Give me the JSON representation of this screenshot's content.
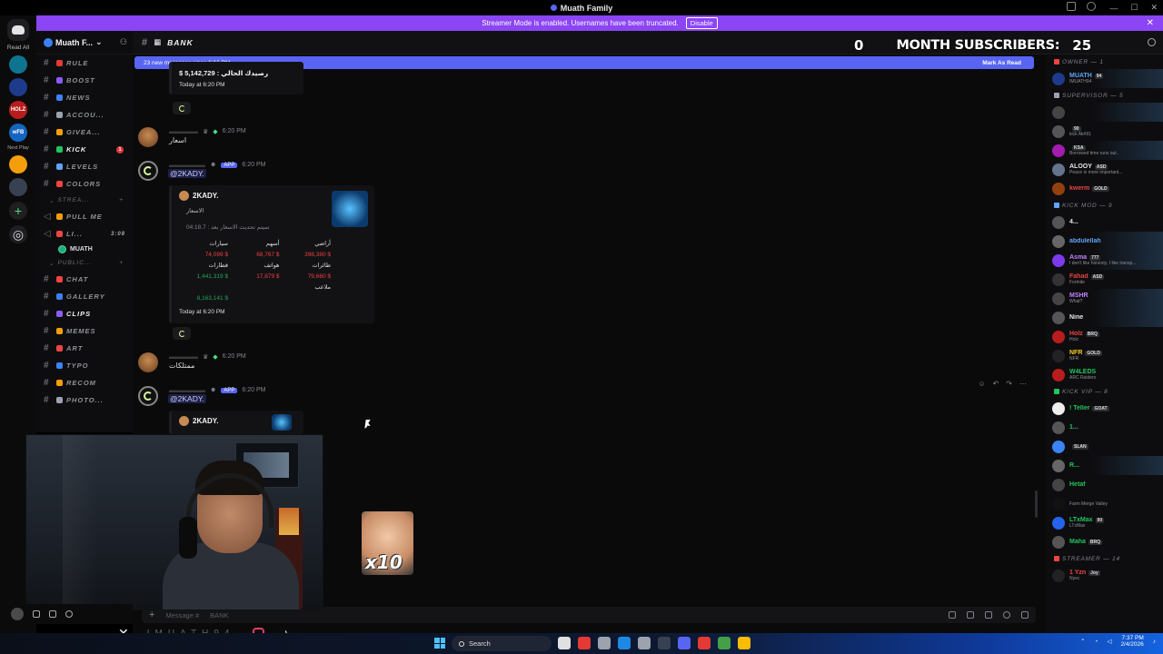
{
  "window": {
    "title": "Muath Family"
  },
  "banner": {
    "text": "Streamer Mode is enabled. Usernames have been truncated.",
    "disable_label": "Disable"
  },
  "rail": {
    "read_all": "Read All",
    "servers": [
      {
        "label": "HOLZ",
        "color": "#e53935"
      },
      {
        "label": "wFB",
        "color": "#1565c0"
      }
    ],
    "next_play": "Next Play"
  },
  "sidebar": {
    "server_name": "Muath F...",
    "channels": [
      {
        "name": "RULE",
        "color": "#e53935"
      },
      {
        "name": "BOOST",
        "color": "#8b5cf6"
      },
      {
        "name": "NEWS",
        "color": "#3b82f6"
      },
      {
        "name": "ACCOU...",
        "color": "#9ca3af"
      },
      {
        "name": "GIVEA...",
        "color": "#f59e0b"
      },
      {
        "name": "KICK",
        "color": "#22c55e",
        "active": true,
        "mention": "1"
      },
      {
        "name": "LEVELS",
        "color": "#60a5fa"
      },
      {
        "name": "COLORS",
        "color": "#ef4444"
      }
    ],
    "category_voice": "STREA...",
    "voice_channels": [
      {
        "name": "PULL ME",
        "color": "#f59e0b"
      },
      {
        "name": "LI...",
        "color": "#ef4444",
        "time": "3:08"
      }
    ],
    "voice_user": "MUATH",
    "category_public": "PUBLIC...",
    "public_channels": [
      {
        "name": "CHAT",
        "color": "#ef4444"
      },
      {
        "name": "GALLERY",
        "color": "#3b82f6"
      },
      {
        "name": "CLIPS",
        "color": "#8b5cf6",
        "active": true
      },
      {
        "name": "MEMES",
        "color": "#f59e0b"
      },
      {
        "name": "ART",
        "color": "#ef4444"
      },
      {
        "name": "TYPO",
        "color": "#3b82f6"
      },
      {
        "name": "RECOM",
        "color": "#f59e0b"
      },
      {
        "name": "PHOTO...",
        "color": "#9ca3af"
      }
    ]
  },
  "header": {
    "channel": "BANK",
    "sub_count_left": "0",
    "sub_label": "MONTH SUBSCRIBERS:",
    "sub_count_right": "25"
  },
  "chat": {
    "new_messages": "23 new messages since 6:16 PM",
    "mark_as_read": "Mark As Read",
    "top_amount": "$ 5,142,729 : رصيدك الحالي",
    "top_time": "Today at 6:20 PM",
    "msg1": {
      "time": "6:20 PM",
      "text": "اسعار"
    },
    "msg2": {
      "time": "6:20 PM",
      "app": "APP",
      "mention": "@2KADY.",
      "embed_name": "2KADY.",
      "embed_sub": "الاسعار",
      "embed_timer": "04:18.7 : سيتم تحديث الاسعار بعد",
      "grid": [
        [
          {
            "t": "سيارات",
            "c": ""
          },
          {
            "t": "أسهم",
            "c": ""
          },
          {
            "t": "أراضي",
            "c": ""
          }
        ],
        [
          {
            "t": "74,099 $",
            "c": "r"
          },
          {
            "t": "68,767 $",
            "c": "r"
          },
          {
            "t": "398,380 $",
            "c": "r"
          }
        ],
        [
          {
            "t": "قطارات",
            "c": ""
          },
          {
            "t": "هواتف",
            "c": ""
          },
          {
            "t": "طائرات",
            "c": ""
          }
        ],
        [
          {
            "t": "1,441,319 $",
            "c": "g"
          },
          {
            "t": "17,879 $",
            "c": "r"
          },
          {
            "t": "79,660 $",
            "c": "r"
          }
        ],
        [
          {
            "t": "",
            "c": ""
          },
          {
            "t": "",
            "c": ""
          },
          {
            "t": "ملاعب",
            "c": ""
          }
        ],
        [
          {
            "t": "8,163,141 $",
            "c": "g"
          },
          {
            "t": "",
            "c": ""
          },
          {
            "t": "",
            "c": ""
          }
        ]
      ],
      "embed_time": "Today at 6:20 PM"
    },
    "msg3": {
      "time": "6:20 PM",
      "text": "ممتلكات"
    },
    "msg4": {
      "time": "6:20 PM",
      "app": "APP",
      "mention": "@2KADY.",
      "embed_name": "2KADY."
    },
    "composer_placeholder": "Message #",
    "composer_channel": "BANK"
  },
  "members": {
    "groups": [
      {
        "title": "OWNER — 1",
        "color": "#ef4444",
        "items": [
          {
            "name": "MUATH",
            "tag": "94",
            "status": "IMUATH94",
            "color": "#60a5fa",
            "av": "#1e3a8a",
            "bg": true
          }
        ]
      },
      {
        "title": "SUPERVISOR — 5",
        "color": "#9ca3af",
        "items": [
          {
            "name": "",
            "tag": "",
            "status": "",
            "color": "#ef4444",
            "av": "#444",
            "bg": true
          },
          {
            "name": "",
            "tag": "90",
            "status": "kick Ak#91",
            "color": "#9ca3af",
            "av": "#555"
          },
          {
            "name": "",
            "tag": "KSA",
            "status": "Borrowed time runs out..",
            "color": "#c084fc",
            "av": "#a21caf",
            "bg": true
          },
          {
            "name": "ALOOY",
            "tag": "ASD",
            "status": "Peace is more important...",
            "color": "#e5e7eb",
            "av": "#64748b"
          },
          {
            "name": "kwerm",
            "tag": "GOLD",
            "status": "",
            "color": "#ef4444",
            "av": "#92400e"
          }
        ]
      },
      {
        "title": "KICK MOD — 9",
        "color": "#60a5fa",
        "items": [
          {
            "name": "4...",
            "tag": "",
            "status": "",
            "color": "#e5e7eb",
            "av": "#555"
          },
          {
            "name": "abdulellah",
            "tag": "",
            "status": "",
            "color": "#60a5fa",
            "av": "#666",
            "bg": true
          },
          {
            "name": "Asma",
            "tag": "777",
            "status": "I don't like honesty, I like transp...",
            "color": "#c084fc",
            "av": "#7c3aed",
            "bg": true
          },
          {
            "name": "Fahad",
            "tag": "ASD",
            "status": "Fortnite",
            "color": "#ef4444",
            "av": "#333"
          },
          {
            "name": "MSHR",
            "tag": "",
            "status": "What?",
            "color": "#c084fc",
            "av": "#444",
            "bg": true
          },
          {
            "name": "Nine",
            "tag": "",
            "status": "",
            "color": "#e5e7eb",
            "av": "#555",
            "bg": true
          },
          {
            "name": "Holz",
            "tag": "BRQ",
            "status": "Holz",
            "color": "#ef4444",
            "av": "#b91c1c"
          },
          {
            "name": "NFR",
            "tag": "GOLD",
            "status": "NFR",
            "color": "#facc15",
            "av": "#222"
          },
          {
            "name": "W4LEDS",
            "tag": "",
            "status": "ARC Raiders",
            "color": "#22c55e",
            "av": "#b91c1c"
          }
        ]
      },
      {
        "title": "KICK VIP — 8",
        "color": "#22c55e",
        "items": [
          {
            "name": "! Teller",
            "tag": "GOAT",
            "status": "",
            "color": "#22c55e",
            "av": "#eee"
          },
          {
            "name": "1...",
            "tag": "",
            "status": "",
            "color": "#22c55e",
            "av": "#555"
          },
          {
            "name": "",
            "tag": "SLAN",
            "status": "",
            "color": "#22c55e",
            "av": "#3b82f6"
          },
          {
            "name": "R...",
            "tag": "",
            "status": "",
            "color": "#22c55e",
            "av": "#666",
            "bg": true
          },
          {
            "name": "Hetaf",
            "tag": "",
            "status": "",
            "color": "#22c55e",
            "av": "#444"
          },
          {
            "name": "",
            "tag": "",
            "status": "Farm Merge Valley",
            "color": "#22c55e",
            "av": "#111"
          },
          {
            "name": "LTxMax",
            "tag": "90",
            "status": "LTxMax",
            "color": "#22c55e",
            "av": "#2563eb"
          },
          {
            "name": "Maha",
            "tag": "BRQ",
            "status": "",
            "color": "#22c55e",
            "av": "#555"
          }
        ]
      },
      {
        "title": "STREAMER — 14",
        "color": "#ef4444",
        "items": [
          {
            "name": "1 Yzn",
            "tag": "Joy",
            "status": "Nyec",
            "color": "#ef4444",
            "av": "#222"
          }
        ]
      }
    ]
  },
  "composer": {
    "placeholder": "Message #",
    "channel": "BANK"
  },
  "taskbar": {
    "search": "Search",
    "time": "7:37 PM",
    "date": "2/4/2026"
  },
  "overlay": {
    "handle": "IMUATH94"
  },
  "sticker": {
    "label": "x10"
  }
}
